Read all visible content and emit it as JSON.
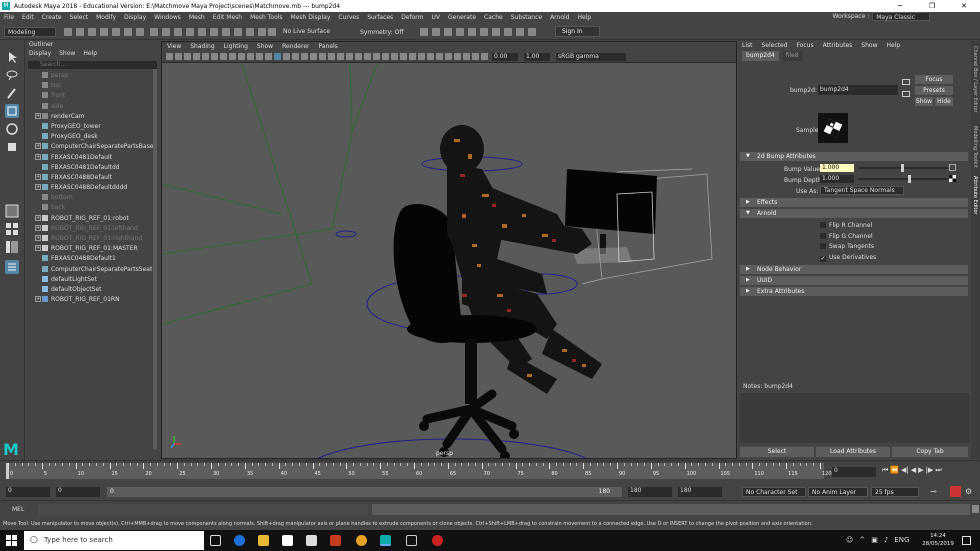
{
  "window": {
    "title": "Autodesk Maya 2018 - Educational Version: E:\\Matchmove Maya Project\\scenes\\Matchmove.mb  ---  bump2d4",
    "controls": [
      "─",
      "❐",
      "✕"
    ]
  },
  "menubar": {
    "items": [
      "File",
      "Edit",
      "Create",
      "Select",
      "Modify",
      "Display",
      "Windows",
      "Mesh",
      "Edit Mesh",
      "Mesh Tools",
      "Mesh Display",
      "Curves",
      "Surfaces",
      "Deform",
      "UV",
      "Generate",
      "Cache",
      "Substance",
      "Arnold",
      "Help"
    ],
    "workspace_label": "Workspace :",
    "workspace_value": "Maya Classic"
  },
  "statusline": {
    "mode": "Modeling",
    "live_surface": "No Live Surface",
    "symmetry": "Symmetry: Off",
    "sign_in": "Sign In"
  },
  "outliner": {
    "title": "Outliner",
    "menu": [
      "Display",
      "Show",
      "Help"
    ],
    "search_placeholder": "Search...",
    "items": [
      {
        "label": "persp",
        "dim": true,
        "expand": false,
        "icon": "camera-icon"
      },
      {
        "label": "top",
        "dim": true,
        "expand": false,
        "icon": "camera-icon"
      },
      {
        "label": "front",
        "dim": true,
        "expand": false,
        "icon": "camera-icon"
      },
      {
        "label": "side",
        "dim": true,
        "expand": false,
        "icon": "camera-icon"
      },
      {
        "label": "renderCam",
        "dim": false,
        "expand": true,
        "icon": "camera-icon"
      },
      {
        "label": "ProxyGEO_tower",
        "dim": false,
        "expand": false,
        "icon": "mesh-icon"
      },
      {
        "label": "ProxyGEO_desk",
        "dim": false,
        "expand": false,
        "icon": "mesh-icon"
      },
      {
        "label": "ComputerChairSeparatePartsBase",
        "dim": false,
        "expand": true,
        "icon": "mesh-icon"
      },
      {
        "label": "FBXASC0481Default",
        "dim": false,
        "expand": true,
        "icon": "mesh-icon"
      },
      {
        "label": "FBXASC0481Defaultdd",
        "dim": false,
        "expand": false,
        "icon": "mesh-icon"
      },
      {
        "label": "FBXASC0488Default",
        "dim": false,
        "expand": true,
        "icon": "mesh-icon"
      },
      {
        "label": "FBXASC0488Defaultdddd",
        "dim": false,
        "expand": true,
        "icon": "mesh-icon"
      },
      {
        "label": "bottom",
        "dim": true,
        "expand": false,
        "icon": "camera-icon"
      },
      {
        "label": "back",
        "dim": true,
        "expand": false,
        "icon": "camera-icon"
      },
      {
        "label": "ROBOT_RIG_REF_01:robot",
        "dim": false,
        "expand": true,
        "icon": "group-icon"
      },
      {
        "label": "ROBOT_RIG_REF_01:lefthand",
        "dim": true,
        "expand": true,
        "icon": "group-icon"
      },
      {
        "label": "ROBOT_RIG_REF_01:righthand",
        "dim": true,
        "expand": true,
        "icon": "group-icon"
      },
      {
        "label": "ROBOT_RIG_REF_01:MASTER",
        "dim": false,
        "expand": true,
        "icon": "group-icon"
      },
      {
        "label": "FBXASC0488Default1",
        "dim": false,
        "expand": false,
        "icon": "mesh-icon"
      },
      {
        "label": "ComputerChairSeparatePartsSeat",
        "dim": false,
        "expand": false,
        "icon": "mesh-icon"
      },
      {
        "label": "defaultLightSet",
        "dim": false,
        "expand": false,
        "icon": "set-icon"
      },
      {
        "label": "defaultObjectSet",
        "dim": false,
        "expand": false,
        "icon": "set-icon"
      },
      {
        "label": "ROBOT_RIG_REF_01RN",
        "dim": false,
        "expand": true,
        "icon": "reference-icon"
      }
    ]
  },
  "viewport": {
    "menu": [
      "View",
      "Shading",
      "Lighting",
      "Show",
      "Renderer",
      "Panels"
    ],
    "exposure": "0.00",
    "gamma": "1.00",
    "color_space": "sRGB gamma",
    "camera_label": "persp"
  },
  "attribute_editor": {
    "menu": [
      "List",
      "Selected",
      "Focus",
      "Attributes",
      "Show",
      "Help"
    ],
    "tabs": [
      "bump2d4",
      "file8"
    ],
    "node_type_label": "bump2d:",
    "node_name": "bump2d4",
    "focus_label": "Focus",
    "presets_label": "Presets",
    "show_label": "Show",
    "hide_label": "Hide",
    "sample_label": "Sample",
    "sections": {
      "bump": "2d Bump Attributes",
      "effects": "Effects",
      "arnold": "Arnold",
      "node_behavior": "Node Behavior",
      "uuid": "UUID",
      "extra": "Extra Attributes"
    },
    "bump_value_label": "Bump Value",
    "bump_value": "1.000",
    "bump_depth_label": "Bump Depth",
    "bump_depth": "1.000",
    "use_as_label": "Use As:",
    "use_as_value": "Tangent Space Normals",
    "arnold_flags": [
      {
        "label": "Flip R Channel",
        "checked": false
      },
      {
        "label": "Flip G Channel",
        "checked": false
      },
      {
        "label": "Swap Tangents",
        "checked": false
      },
      {
        "label": "Use Derivatives",
        "checked": true
      }
    ],
    "notes_label": "Notes:  bump2d4",
    "bottom_buttons": [
      "Select",
      "Load Attributes",
      "Copy Tab"
    ]
  },
  "right_strip": [
    "Channel Box / Layer Editor",
    "Modelling Toolkit",
    "Attribute Editor"
  ],
  "timeline": {
    "ticks": [
      "0",
      "5",
      "10",
      "15",
      "20",
      "25",
      "30",
      "35",
      "40",
      "45",
      "50",
      "55",
      "60",
      "65",
      "70",
      "75",
      "80",
      "85",
      "90",
      "95",
      "100",
      "105",
      "110",
      "115",
      "120"
    ],
    "current_frame": "0"
  },
  "range": {
    "start": "0",
    "anim_start": "0",
    "inner_start": "0",
    "inner_end": "180",
    "anim_end": "180",
    "end": "180",
    "character_set": "No Character Set",
    "anim_layer": "No Anim Layer",
    "fps": "25 fps"
  },
  "cmdline": {
    "label": "MEL"
  },
  "help_line": "Move Tool: Use manipulator to move object(s). Ctrl+MMB+drag to move components along normals. Shift+drag manipulator axis or plane handles to extrude components or clone objects. Ctrl+Shift+LMB+drag to constrain movement to a connected edge. Use D or INSERT to change the pivot position and axis orientation.",
  "taskbar": {
    "search_placeholder": "Type here to search",
    "time": "14:24",
    "date": "28/05/2019"
  },
  "colors": {
    "accent": "#1ac6c6",
    "field_highlight": "#ffffc0",
    "viewport_bg": "#595959"
  }
}
